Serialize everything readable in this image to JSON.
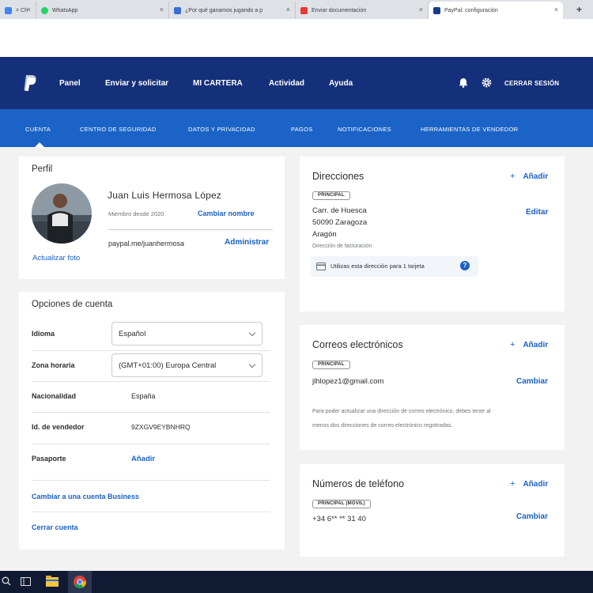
{
  "browser": {
    "tabs": [
      {
        "label": "= Ch",
        "color": "#4285f4",
        "active": false
      },
      {
        "label": "WhatsApp",
        "color": "#25d366",
        "active": false
      },
      {
        "label": "¿Por qué ganamos jugando a p",
        "color": "#3b6fd8",
        "active": false
      },
      {
        "label": "Enviar documentación",
        "color": "#e53935",
        "active": false
      },
      {
        "label": "PayPal: configuración",
        "color": "#1b3a8c",
        "active": true
      }
    ],
    "new_tab": "+"
  },
  "header": {
    "nav": [
      "Panel",
      "Enviar y solicitar",
      "MI CARTERA",
      "Actividad",
      "Ayuda"
    ],
    "logout": "CERRAR SESIÓN"
  },
  "subnav": {
    "items": [
      "CUENTA",
      "CENTRO DE SEGURIDAD",
      "DATOS Y PRIVACIDAD",
      "PAGOS",
      "NOTIFICACIONES",
      "HERRAMIENTAS DE VENDEDOR"
    ]
  },
  "profile": {
    "title": "Perfil",
    "name": "Juan Luis Hermosa López",
    "member_since": "Miembro desde 2020",
    "change_name": "Cambiar nombre",
    "paypal_me": "paypal.me/juanhermosa",
    "manage": "Administrar",
    "update_photo": "Actualizar foto"
  },
  "account_options": {
    "title": "Opciones de cuenta",
    "language_label": "Idioma",
    "language_value": "Español",
    "timezone_label": "Zona horaria",
    "timezone_value": "(GMT+01:00) Europa Central",
    "nationality_label": "Nacionalidad",
    "nationality_value": "España",
    "seller_id_label": "Id. de vendedor",
    "seller_id_value": "9ZXGV9EYBNHRQ",
    "passport_label": "Pasaporte",
    "passport_action": "Añadir",
    "business_link": "Cambiar a una cuenta Business",
    "close_link": "Cerrar cuenta"
  },
  "addresses": {
    "title": "Direcciones",
    "add": "Añadir",
    "plus": "+",
    "badge": "PRINCIPAL",
    "line1": "Carr. de Huesca",
    "line2": "50090 Zaragoza",
    "line3": "Aragón",
    "billing": "Dirección de facturación",
    "edit": "Editar",
    "card_note": "Utilizas esta dirección para 1 tarjeta"
  },
  "emails": {
    "title": "Correos electrónicos",
    "add": "Añadir",
    "plus": "+",
    "badge": "PRINCIPAL",
    "email": "jlhlopez1@gmail.com",
    "change": "Cambiar",
    "note_line1": "Para poder actualizar una dirección de correo electrónico, debes tener al",
    "note_line2": "menos dos direcciones de correo electrónico registradas."
  },
  "phones": {
    "title": "Números de teléfono",
    "add": "Añadir",
    "plus": "+",
    "badge": "PRINCIPAL (MÓVIL)",
    "number": "+34 6** ** 31 40",
    "change": "Cambiar"
  },
  "colors": {
    "header": "#15307a",
    "subnav": "#1b63c6",
    "link": "#1a61c4"
  }
}
